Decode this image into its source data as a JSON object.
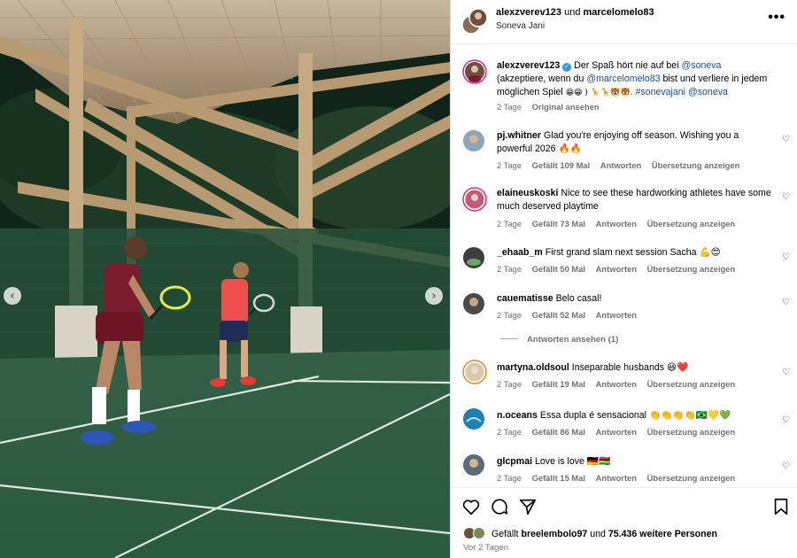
{
  "post": {
    "authors": "alexzverev123",
    "and_word": "und",
    "coauthor": "marcelomelo83",
    "location": "Soneva Jani",
    "more_label": "•••"
  },
  "caption": {
    "user": "alexzverev123",
    "text_1": "Der Spaß hört nie auf bei",
    "tag_1": "@soneva",
    "text_2": "(akzeptiere, wenn du",
    "tag_2": "@marcelomelo83",
    "text_3": "bist und verliere in jedem möglichen Spiel",
    "emojis_1": "😁😁 )",
    "emojis_2": "🦒🦒🐯🐯.",
    "tag_3": "#sonevajani",
    "tag_4": "@soneva",
    "time": "2 Tage",
    "original": "Original ansehen"
  },
  "comments": [
    {
      "user": "pj.whitner",
      "text": "Glad you're enjoying off season. Wishing you a powerful 2026 🔥🔥",
      "time": "2 Tage",
      "likes": "Gefällt 109 Mal",
      "reply": "Antworten",
      "translate": "Übersetzung anzeigen"
    },
    {
      "user": "elaineuskoski",
      "text": "Nice to see these hardworking athletes have some much deserved playtime",
      "time": "2 Tage",
      "likes": "Gefällt 73 Mal",
      "reply": "Antworten",
      "translate": "Übersetzung anzeigen"
    },
    {
      "user": "_ehaab_m",
      "text": "First grand slam next session Sacha 💪😍",
      "time": "2 Tage",
      "likes": "Gefällt 50 Mal",
      "reply": "Antworten",
      "translate": "Übersetzung anzeigen"
    },
    {
      "user": "cauematisse",
      "text": "Belo casal!",
      "time": "2 Tage",
      "likes": "Gefällt 52 Mal",
      "reply": "Antworten",
      "translate": ""
    },
    {
      "user": "martyna.oldsoul",
      "text": "Inseparable husbands 😆❤️",
      "time": "2 Tage",
      "likes": "Gefällt 19 Mal",
      "reply": "Antworten",
      "translate": "Übersetzung anzeigen"
    },
    {
      "user": "n.oceans",
      "text": "Essa dupla é sensacional 👏👏👏👏🇧🇷💛💚",
      "time": "2 Tage",
      "likes": "Gefällt 86 Mal",
      "reply": "Antworten",
      "translate": "Übersetzung anzeigen"
    },
    {
      "user": "glcpmai",
      "text": "Love is love 🇩🇪🇲🇺",
      "time": "2 Tage",
      "likes": "Gefällt 15 Mal",
      "reply": "Antworten",
      "translate": "Übersetzung anzeigen"
    }
  ],
  "replies_label": "Antworten ansehen (1)",
  "footer": {
    "liked_prefix": "Gefällt",
    "liked_user": "breelembolo97",
    "liked_and": "und",
    "liked_rest": "75.436 weitere Personen",
    "time": "Vor 2 Tagen"
  },
  "icons": {
    "like": "heart-icon",
    "comment": "comment-icon",
    "share": "share-icon",
    "save": "bookmark-icon",
    "prev": "chevron-left-icon",
    "next": "chevron-right-icon"
  },
  "colors": {
    "link": "#1c4f94",
    "verified": "#3897f0",
    "muted": "#737373",
    "court": "#2e6848"
  }
}
